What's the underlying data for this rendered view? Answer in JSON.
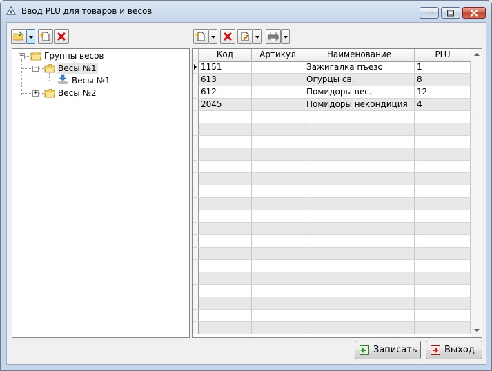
{
  "window": {
    "title": "Ввод PLU для товаров и весов"
  },
  "tree": {
    "root": {
      "label": "Группы весов"
    },
    "group1": {
      "label": "Весы №1"
    },
    "group1_child": {
      "label": "Весы №1"
    },
    "group2": {
      "label": "Весы №2"
    }
  },
  "grid": {
    "columns": [
      "Код",
      "Артикул",
      "Наименование",
      "PLU"
    ],
    "rows": [
      {
        "code": "1151",
        "article": "",
        "name": "Зажигалка пъезо",
        "plu": "1"
      },
      {
        "code": "613",
        "article": "",
        "name": "Огурцы св.",
        "plu": "8"
      },
      {
        "code": "612",
        "article": "",
        "name": "Помидоры вес.",
        "plu": "12"
      },
      {
        "code": "2045",
        "article": "",
        "name": "Помидоры некондиция",
        "plu": "4"
      }
    ]
  },
  "buttons": {
    "save": "Записать",
    "exit": "Выход"
  },
  "colors": {
    "title_gradient": "#c6d6ea",
    "close_button": "#c3422a",
    "selected_tree_item": "#e6e6e6",
    "alt_row": "#e8e8e8"
  }
}
